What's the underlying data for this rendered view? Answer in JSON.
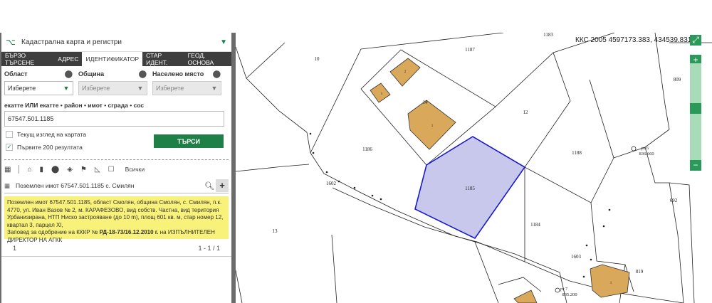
{
  "header": {
    "title": "Кадастрална карта и регистри"
  },
  "tabs": [
    {
      "label": "БЪРЗО ТЪРСЕНЕ",
      "active": false
    },
    {
      "label": "АДРЕС",
      "active": false
    },
    {
      "label": "ИДЕНТИФИКАТОР",
      "active": true
    },
    {
      "label": "СТАР ИДЕНТ.",
      "active": false
    },
    {
      "label": "ГЕОД. ОСНОВА",
      "active": false
    }
  ],
  "filters": {
    "oblast_label": "Област",
    "obshtina_label": "Община",
    "naseleno_label": "Населено място",
    "oblast_value": "Изберете",
    "obshtina_value": "Изберете",
    "naseleno_value": "Изберете"
  },
  "ekatte": {
    "label": "екатте ИЛИ екатте • район • имот • сграда • сос",
    "value": "67547.501.1185"
  },
  "options": {
    "current_view_label": "Текущ изглед на картата",
    "first200_label": "Първите 200 резултата",
    "first200_checked": true
  },
  "search_button": "ТЪРСИ",
  "layer_filter": {
    "all_label": "Всички"
  },
  "result": {
    "title": "Поземлен имот 67547.501.1185 с. Смилян",
    "line1": "Поземлен имот 67547.501.1185, област Смолян, община Смолян, с. Смилян, п.к. 4770, ул. Иван Вазов № 2, м. КАРАФЕЗОВО, вид собств. Частна, вид територия Урбанизирана, НТП Ниско застрояване (до 10 m), площ 601 кв. м, стар номер 12, квартал 3, парцел XI,",
    "line2_pre": "Заповед за одобрение на КККР № ",
    "line2_bold": "РД-18-73/16.12.2010 г.",
    "line2_post": " на ИЗПЪЛНИТЕЛЕН ДИРЕКТОР НА АГКК"
  },
  "pager": {
    "page": "1",
    "range": "1 - 1 / 1"
  },
  "map": {
    "coords": "ККС 2005 4597173.383, 434539.831",
    "selected_parcel": "1185",
    "parcel_labels": [
      "10",
      "1187",
      "1185",
      "12",
      "1186",
      "1188",
      "809",
      "1602",
      "1184",
      "13",
      "1603",
      "819",
      "692",
      "1183",
      "14"
    ],
    "building_labels": [
      "2",
      "1",
      "1",
      "1"
    ],
    "points": [
      {
        "name": "рт 6",
        "elev": "836.660"
      },
      {
        "name": "рт 7",
        "elev": "835.200"
      }
    ],
    "parcel_fill": "#c8c8ec",
    "parcel_stroke": "#1a1ac8",
    "building_fill": "#d9a85a"
  },
  "colors": {
    "accent": "#1e7f47",
    "tab_bar": "#3e3e3e",
    "info_bg": "#f8f27a"
  }
}
